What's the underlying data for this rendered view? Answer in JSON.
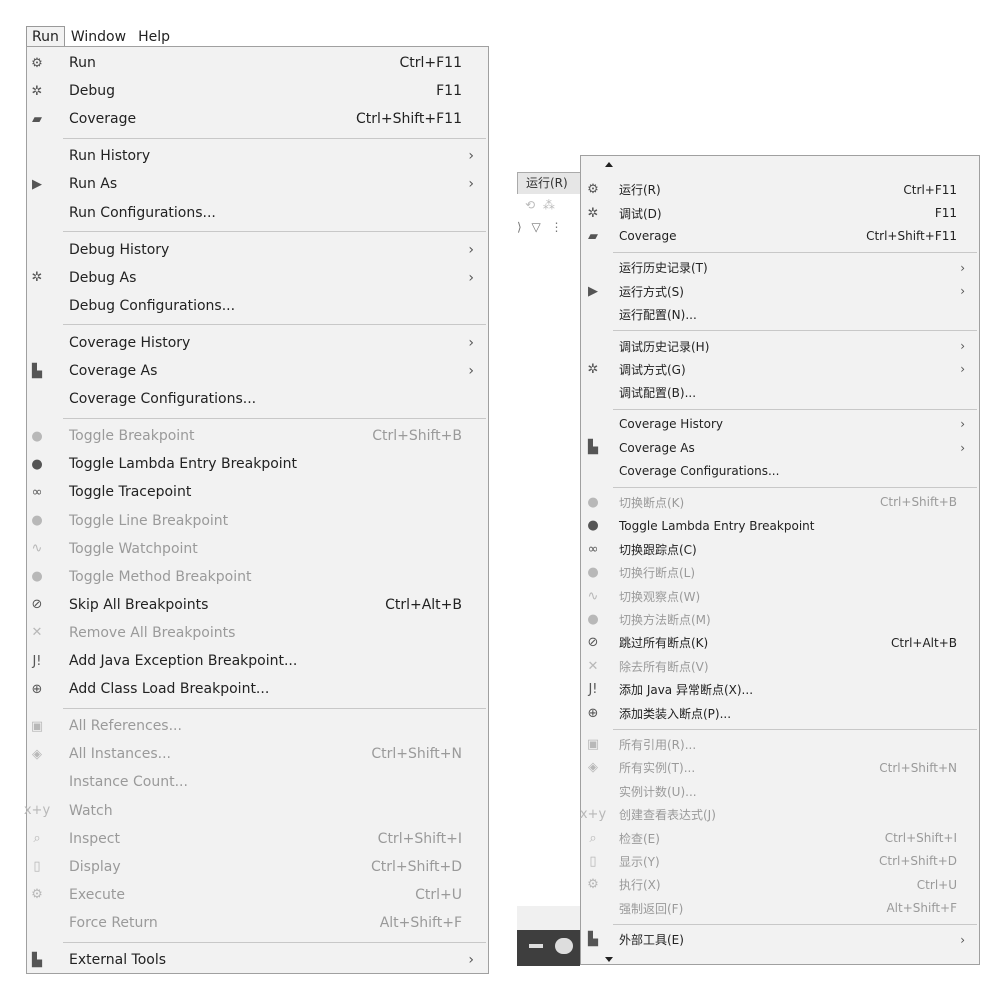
{
  "menubar": {
    "run": "Run",
    "window": "Window",
    "help": "Help"
  },
  "left_menu": {
    "items": [
      {
        "label": "Run",
        "shortcut": "Ctrl+F11",
        "icon": "run-icon",
        "glyph": "⚙",
        "disabled": false
      },
      {
        "label": "Debug",
        "shortcut": "F11",
        "icon": "bug-icon",
        "glyph": "✲",
        "disabled": false
      },
      {
        "label": "Coverage",
        "shortcut": "Ctrl+Shift+F11",
        "icon": "coverage-icon",
        "glyph": "▰",
        "disabled": false
      },
      {
        "label": "Run History",
        "submenu": true,
        "disabled": false
      },
      {
        "label": "Run As",
        "submenu": true,
        "icon": "play-circle-icon",
        "glyph": "▶",
        "disabled": false
      },
      {
        "label": "Run Configurations...",
        "disabled": false
      },
      {
        "label": "Debug History",
        "submenu": true,
        "disabled": false
      },
      {
        "label": "Debug As",
        "submenu": true,
        "icon": "bug-icon",
        "glyph": "✲",
        "disabled": false
      },
      {
        "label": "Debug Configurations...",
        "disabled": false
      },
      {
        "label": "Coverage History",
        "submenu": true,
        "disabled": false
      },
      {
        "label": "Coverage As",
        "submenu": true,
        "icon": "coverage-as-icon",
        "glyph": "▙",
        "disabled": false
      },
      {
        "label": "Coverage Configurations...",
        "disabled": false
      },
      {
        "label": "Toggle Breakpoint",
        "shortcut": "Ctrl+Shift+B",
        "icon": "breakpoint-icon",
        "glyph": "●",
        "disabled": true
      },
      {
        "label": "Toggle Lambda Entry Breakpoint",
        "icon": "lambda-breakpoint-icon",
        "glyph": "●",
        "disabled": false
      },
      {
        "label": "Toggle Tracepoint",
        "icon": "tracepoint-icon",
        "glyph": "∞",
        "disabled": false
      },
      {
        "label": "Toggle Line Breakpoint",
        "icon": "line-breakpoint-icon",
        "glyph": "●",
        "disabled": true
      },
      {
        "label": "Toggle Watchpoint",
        "icon": "watchpoint-icon",
        "glyph": "∿",
        "disabled": true
      },
      {
        "label": "Toggle Method Breakpoint",
        "icon": "method-breakpoint-icon",
        "glyph": "●",
        "disabled": true
      },
      {
        "label": "Skip All Breakpoints",
        "shortcut": "Ctrl+Alt+B",
        "icon": "skip-breakpoints-icon",
        "glyph": "⊘",
        "disabled": false
      },
      {
        "label": "Remove All Breakpoints",
        "icon": "remove-breakpoints-icon",
        "glyph": "✕",
        "disabled": true
      },
      {
        "label": "Add Java Exception Breakpoint...",
        "icon": "java-exception-icon",
        "glyph": "J!",
        "disabled": false
      },
      {
        "label": "Add Class Load Breakpoint...",
        "icon": "class-load-icon",
        "glyph": "⊕",
        "disabled": false
      },
      {
        "label": "All References...",
        "icon": "references-icon",
        "glyph": "▣",
        "disabled": true
      },
      {
        "label": "All Instances...",
        "shortcut": "Ctrl+Shift+N",
        "icon": "instances-icon",
        "glyph": "◈",
        "disabled": true
      },
      {
        "label": "Instance Count...",
        "disabled": true
      },
      {
        "label": "Watch",
        "icon": "watch-icon",
        "glyph": "x+y",
        "disabled": true
      },
      {
        "label": "Inspect",
        "shortcut": "Ctrl+Shift+I",
        "icon": "inspect-icon",
        "glyph": "⌕",
        "disabled": true
      },
      {
        "label": "Display",
        "shortcut": "Ctrl+Shift+D",
        "icon": "display-icon",
        "glyph": "▯",
        "disabled": true
      },
      {
        "label": "Execute",
        "shortcut": "Ctrl+U",
        "icon": "execute-icon",
        "glyph": "⚙",
        "disabled": true
      },
      {
        "label": "Force Return",
        "shortcut": "Alt+Shift+F",
        "disabled": true
      },
      {
        "label": "External Tools",
        "submenu": true,
        "icon": "external-tools-icon",
        "glyph": "▙",
        "disabled": false
      }
    ]
  },
  "ide_fragment": {
    "run_menu": "运行(R)"
  },
  "right_menu": {
    "items": [
      {
        "label": "运行(R)",
        "shortcut": "Ctrl+F11",
        "icon": "run-icon",
        "glyph": "⚙",
        "disabled": false
      },
      {
        "label": "调试(D)",
        "shortcut": "F11",
        "icon": "bug-icon",
        "glyph": "✲",
        "disabled": false
      },
      {
        "label": "Coverage",
        "shortcut": "Ctrl+Shift+F11",
        "icon": "coverage-icon",
        "glyph": "▰",
        "disabled": false
      },
      {
        "label": "运行历史记录(T)",
        "submenu": true,
        "disabled": false
      },
      {
        "label": "运行方式(S)",
        "submenu": true,
        "icon": "play-circle-icon",
        "glyph": "▶",
        "disabled": false
      },
      {
        "label": "运行配置(N)...",
        "disabled": false
      },
      {
        "label": "调试历史记录(H)",
        "submenu": true,
        "disabled": false
      },
      {
        "label": "调试方式(G)",
        "submenu": true,
        "icon": "bug-icon",
        "glyph": "✲",
        "disabled": false
      },
      {
        "label": "调试配置(B)...",
        "disabled": false
      },
      {
        "label": "Coverage History",
        "submenu": true,
        "disabled": false
      },
      {
        "label": "Coverage As",
        "submenu": true,
        "icon": "coverage-as-icon",
        "glyph": "▙",
        "disabled": false
      },
      {
        "label": "Coverage Configurations...",
        "disabled": false
      },
      {
        "label": "切换断点(K)",
        "shortcut": "Ctrl+Shift+B",
        "icon": "breakpoint-icon",
        "glyph": "●",
        "disabled": true
      },
      {
        "label": "Toggle Lambda Entry Breakpoint",
        "icon": "lambda-breakpoint-icon",
        "glyph": "●",
        "disabled": false
      },
      {
        "label": "切换跟踪点(C)",
        "icon": "tracepoint-icon",
        "glyph": "∞",
        "disabled": false
      },
      {
        "label": "切换行断点(L)",
        "icon": "line-breakpoint-icon",
        "glyph": "●",
        "disabled": true
      },
      {
        "label": "切换观察点(W)",
        "icon": "watchpoint-icon",
        "glyph": "∿",
        "disabled": true
      },
      {
        "label": "切换方法断点(M)",
        "icon": "method-breakpoint-icon",
        "glyph": "●",
        "disabled": true
      },
      {
        "label": "跳过所有断点(K)",
        "shortcut": "Ctrl+Alt+B",
        "icon": "skip-breakpoints-icon",
        "glyph": "⊘",
        "disabled": false
      },
      {
        "label": "除去所有断点(V)",
        "icon": "remove-breakpoints-icon",
        "glyph": "✕",
        "disabled": true
      },
      {
        "label": "添加 Java 异常断点(X)...",
        "icon": "java-exception-icon",
        "glyph": "J!",
        "disabled": false
      },
      {
        "label": "添加类装入断点(P)...",
        "icon": "class-load-icon",
        "glyph": "⊕",
        "disabled": false
      },
      {
        "label": "所有引用(R)...",
        "icon": "references-icon",
        "glyph": "▣",
        "disabled": true
      },
      {
        "label": "所有实例(T)...",
        "shortcut": "Ctrl+Shift+N",
        "icon": "instances-icon",
        "glyph": "◈",
        "disabled": true
      },
      {
        "label": "实例计数(U)...",
        "disabled": true
      },
      {
        "label": "创建查看表达式(J)",
        "icon": "watch-icon",
        "glyph": "x+y",
        "disabled": true
      },
      {
        "label": "检查(E)",
        "shortcut": "Ctrl+Shift+I",
        "icon": "inspect-icon",
        "glyph": "⌕",
        "disabled": true
      },
      {
        "label": "显示(Y)",
        "shortcut": "Ctrl+Shift+D",
        "icon": "display-icon",
        "glyph": "▯",
        "disabled": true
      },
      {
        "label": "执行(X)",
        "shortcut": "Ctrl+U",
        "icon": "execute-icon",
        "glyph": "⚙",
        "disabled": true
      },
      {
        "label": "强制返回(F)",
        "shortcut": "Alt+Shift+F",
        "disabled": true
      },
      {
        "label": "外部工具(E)",
        "submenu": true,
        "icon": "external-tools-icon",
        "glyph": "▙",
        "disabled": false
      }
    ]
  }
}
